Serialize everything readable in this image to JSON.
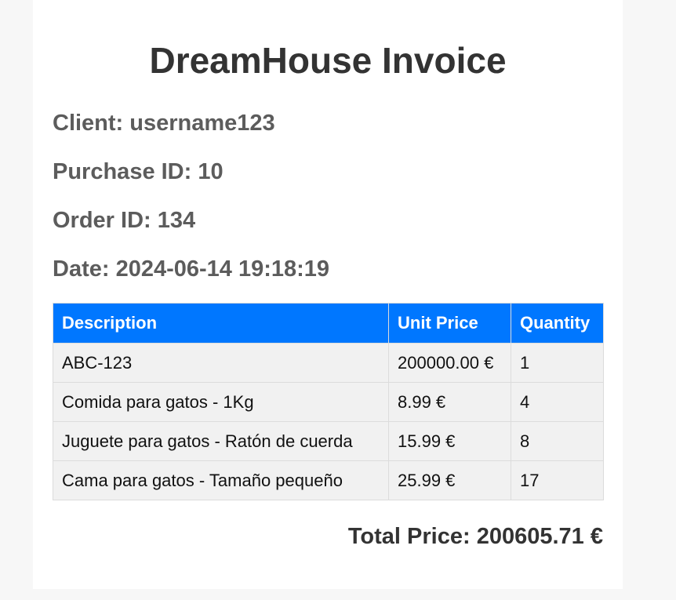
{
  "title": "DreamHouse Invoice",
  "meta": {
    "client": "Client: username123",
    "purchase_id": "Purchase ID: 10",
    "order_id": "Order ID: 134",
    "date": "Date: 2024-06-14 19:18:19"
  },
  "table": {
    "headers": [
      "Description",
      "Unit Price",
      "Quantity"
    ],
    "rows": [
      [
        "ABC-123",
        "200000.00 €",
        "1"
      ],
      [
        "Comida para gatos - 1Kg",
        "8.99 €",
        "4"
      ],
      [
        "Juguete para gatos - Ratón de cuerda",
        "15.99 €",
        "8"
      ],
      [
        "Cama para gatos - Tamaño pequeño",
        "25.99 €",
        "17"
      ]
    ]
  },
  "total": {
    "label": "Total Price:",
    "value": "200605.71 €"
  },
  "colors": {
    "header_bg": "#0077ff",
    "header_text": "#ffffff",
    "row_bg": "#f1f1f1",
    "title_text": "#333333",
    "meta_text": "#5c5c5c"
  }
}
